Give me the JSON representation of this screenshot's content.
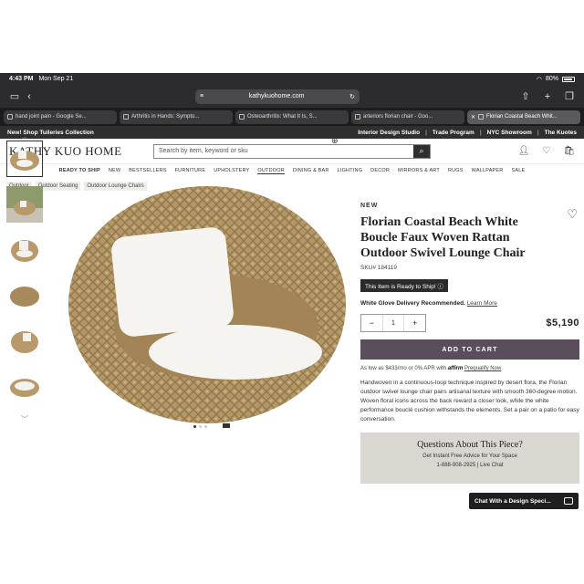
{
  "status_bar": {
    "time": "4:43 PM",
    "date": "Mon Sep 21",
    "battery": "80%"
  },
  "browser": {
    "url": "kathykuohome.com",
    "tabs": [
      {
        "label": "hand joint pain - Google Se..."
      },
      {
        "label": "Arthritis in Hands: Sympto..."
      },
      {
        "label": "Osteoarthritis: What It Is, S..."
      },
      {
        "label": "arteriors florian chair - Goo..."
      },
      {
        "label": "Florian Coastal Beach Whit..."
      }
    ]
  },
  "promo": {
    "left": "New! Shop Tuileries Collection",
    "links": [
      "Interior Design Studio",
      "Trade Program",
      "NYC Showroom",
      "The Kuotes"
    ]
  },
  "header": {
    "logo": "KATHY KUO HOME",
    "search_placeholder": "Search by item, keyword or sku"
  },
  "nav": [
    "READY TO SHIP",
    "NEW",
    "BESTSELLERS",
    "FURNITURE",
    "UPHOLSTERY",
    "OUTDOOR",
    "DINING & BAR",
    "LIGHTING",
    "DECOR",
    "MIRRORS & ART",
    "RUGS",
    "WALLPAPER",
    "SALE"
  ],
  "breadcrumbs": [
    "Outdoor",
    "Outdoor Seating",
    "Outdoor Lounge Chairs"
  ],
  "product": {
    "badge": "NEW",
    "title": "Florian Coastal Beach White Boucle Faux Woven Rattan Outdoor Swivel Lounge Chair",
    "sku": "SKU# 184119",
    "ready_label": "This Item is Ready to Ship! ⓘ",
    "white_glove": "White Glove Delivery Recommended.",
    "learn_more": "Learn More",
    "quantity": "1",
    "price": "$5,190",
    "add_to_cart": "ADD TO CART",
    "afford_text": "As low as $433/mo or 0% APR with",
    "afford_brand": "affirm",
    "afford_link": "Prequalify Now",
    "description": "Handwoven in a continuous-loop technique inspired by desert flora, the Florian outdoor swivel lounge chair pairs artisanal texture with smooth 360-degree motion. Woven floral icons across the back reward a closer look, while the white performance bouclé cushion withstands the elements. Set a pair on a patio for easy conversation."
  },
  "questions": {
    "title": "Questions About This Piece?",
    "subtitle": "Get Instant Free Advice for Your Space",
    "phone": "1-888-908-2925 | Live Chat"
  },
  "chat_button": "Chat With a Design Speci..."
}
